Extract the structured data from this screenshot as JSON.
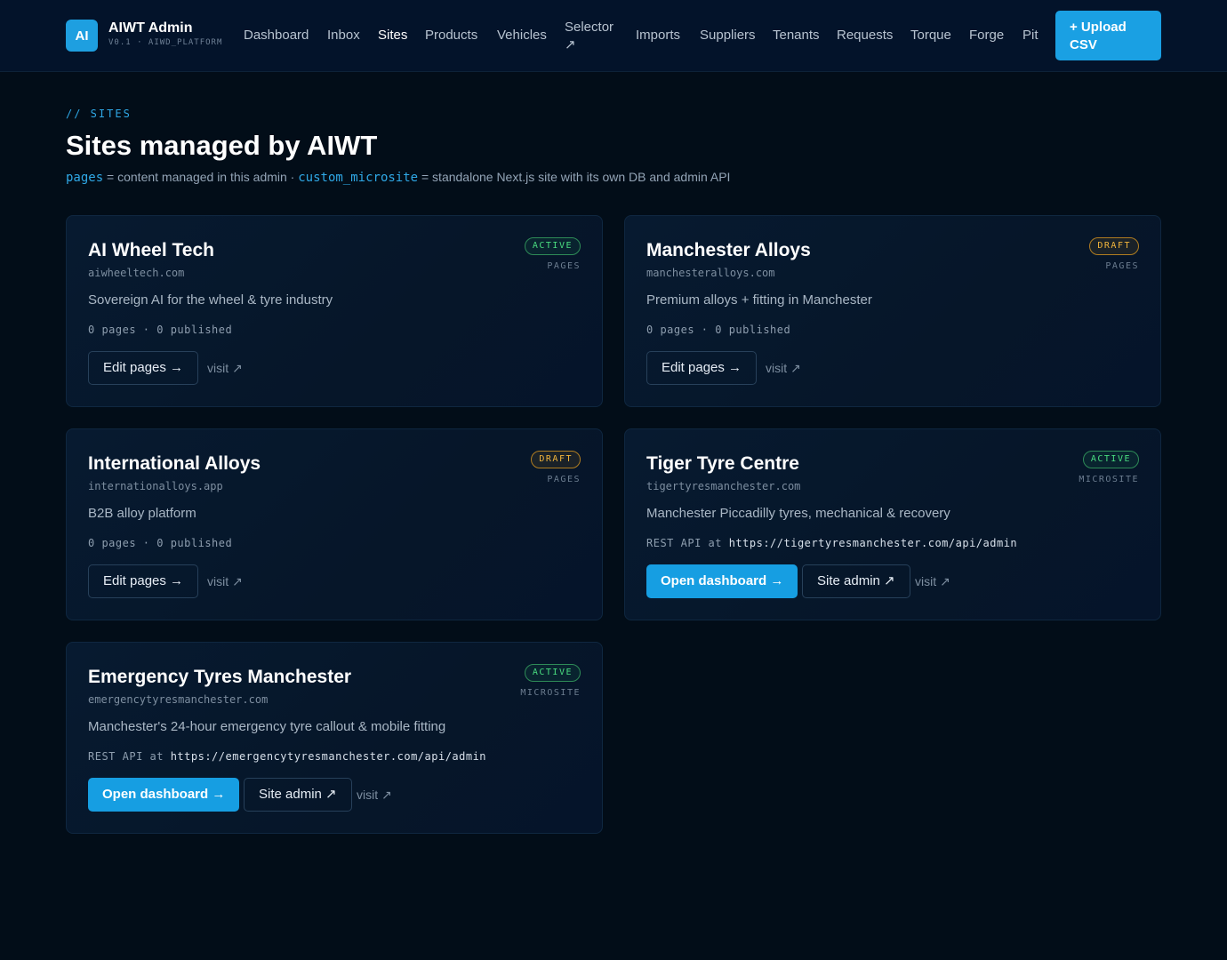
{
  "header": {
    "logo": "AI",
    "title": "AIWT Admin",
    "subtitle": "V0.1 · AIWD_PLATFORM",
    "nav": [
      {
        "label": "Dashboard"
      },
      {
        "label": "Inbox"
      },
      {
        "label": "Sites",
        "active": true
      },
      {
        "label": "Products"
      },
      {
        "label": "Vehicles"
      },
      {
        "label": "Selector ↗"
      },
      {
        "label": "Imports"
      },
      {
        "label": "Suppliers"
      },
      {
        "label": "Tenants"
      },
      {
        "label": "Requests"
      },
      {
        "label": "Torque"
      },
      {
        "label": "Forge"
      },
      {
        "label": "Pit"
      }
    ],
    "upload_button": "+ Upload CSV"
  },
  "page": {
    "eyebrow": "// SITES",
    "title": "Sites managed by AIWT",
    "legend": {
      "term1": "pages",
      "desc1": " = content managed in this admin · ",
      "term2": "custom_microsite",
      "desc2": " = standalone Next.js site with its own DB and admin API"
    }
  },
  "sites": [
    {
      "name": "AI Wheel Tech",
      "domain": "aiwheeltech.com",
      "description": "Sovereign AI for the wheel & tyre industry",
      "meta": "0 pages · 0 published",
      "status": "ACTIVE",
      "kind": "PAGES",
      "edit_label": "Edit pages →",
      "visit_label": "visit ↗"
    },
    {
      "name": "Manchester Alloys",
      "domain": "manchesteralloys.com",
      "description": "Premium alloys + fitting in Manchester",
      "meta": "0 pages · 0 published",
      "status": "DRAFT",
      "kind": "PAGES",
      "edit_label": "Edit pages →",
      "visit_label": "visit ↗"
    },
    {
      "name": "International Alloys",
      "domain": "internationalloys.app",
      "description": "B2B alloy platform",
      "meta": "0 pages · 0 published",
      "status": "DRAFT",
      "kind": "PAGES",
      "edit_label": "Edit pages →",
      "visit_label": "visit ↗"
    },
    {
      "name": "Tiger Tyre Centre",
      "domain": "tigertyresmanchester.com",
      "description": "Manchester Piccadilly tyres, mechanical & recovery",
      "api_prefix": "REST API at ",
      "api_url": "https://tigertyresmanchester.com/api/admin",
      "status": "ACTIVE",
      "kind": "MICROSITE",
      "dashboard_label": "Open dashboard →",
      "admin_label": "Site admin ↗",
      "visit_label": "visit ↗"
    },
    {
      "name": "Emergency Tyres Manchester",
      "domain": "emergencytyresmanchester.com",
      "description": "Manchester's 24-hour emergency tyre callout & mobile fitting",
      "api_prefix": "REST API at ",
      "api_url": "https://emergencytyresmanchester.com/api/admin",
      "status": "ACTIVE",
      "kind": "MICROSITE",
      "dashboard_label": "Open dashboard →",
      "admin_label": "Site admin ↗",
      "visit_label": "visit ↗"
    }
  ],
  "colors": {
    "background": "#020d18",
    "accent": "#1aa0e3",
    "active": "#4ade80",
    "draft": "#f2b53c"
  }
}
